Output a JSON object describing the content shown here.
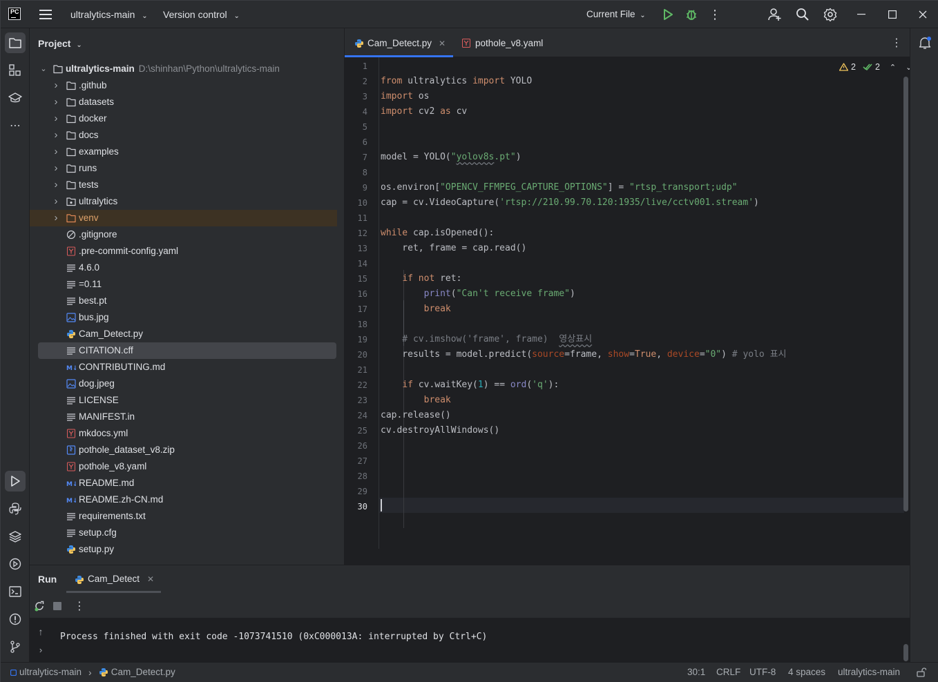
{
  "titlebar": {
    "logo_text": "PC",
    "project_name": "ultralytics-main",
    "vcs_label": "Version control",
    "run_config": "Current File"
  },
  "project_panel": {
    "title": "Project",
    "root": {
      "name": "ultralytics-main",
      "path": "D:\\shinhan\\Python\\ultralytics-main"
    },
    "items": [
      {
        "name": ".github",
        "kind": "folder"
      },
      {
        "name": "datasets",
        "kind": "folder"
      },
      {
        "name": "docker",
        "kind": "folder"
      },
      {
        "name": "docs",
        "kind": "folder"
      },
      {
        "name": "examples",
        "kind": "folder"
      },
      {
        "name": "runs",
        "kind": "folder"
      },
      {
        "name": "tests",
        "kind": "folder"
      },
      {
        "name": "ultralytics",
        "kind": "package"
      },
      {
        "name": "venv",
        "kind": "folder-excluded"
      },
      {
        "name": ".gitignore",
        "kind": "ignore"
      },
      {
        "name": ".pre-commit-config.yaml",
        "kind": "yaml"
      },
      {
        "name": "4.6.0",
        "kind": "text"
      },
      {
        "name": "=0.11",
        "kind": "text"
      },
      {
        "name": "best.pt",
        "kind": "text"
      },
      {
        "name": "bus.jpg",
        "kind": "image"
      },
      {
        "name": "Cam_Detect.py",
        "kind": "python"
      },
      {
        "name": "CITATION.cff",
        "kind": "text"
      },
      {
        "name": "CONTRIBUTING.md",
        "kind": "markdown"
      },
      {
        "name": "dog.jpeg",
        "kind": "image"
      },
      {
        "name": "LICENSE",
        "kind": "text"
      },
      {
        "name": "MANIFEST.in",
        "kind": "text"
      },
      {
        "name": "mkdocs.yml",
        "kind": "yaml"
      },
      {
        "name": "pothole_dataset_v8.zip",
        "kind": "archive"
      },
      {
        "name": "pothole_v8.yaml",
        "kind": "yaml"
      },
      {
        "name": "README.md",
        "kind": "markdown"
      },
      {
        "name": "README.zh-CN.md",
        "kind": "markdown"
      },
      {
        "name": "requirements.txt",
        "kind": "text"
      },
      {
        "name": "setup.cfg",
        "kind": "text"
      },
      {
        "name": "setup.py",
        "kind": "python"
      }
    ],
    "selected_item": "CITATION.cff",
    "highlighted_item": "venv"
  },
  "editor": {
    "tabs": [
      {
        "label": "Cam_Detect.py",
        "active": true
      },
      {
        "label": "pothole_v8.yaml",
        "active": false
      }
    ],
    "warnings_count": "2",
    "ok_count": "2",
    "current_line": "30"
  },
  "run_panel": {
    "title": "Run",
    "tab_label": "Cam_Detect",
    "console_output": "Process finished with exit code -1073741510 (0xC000013A: interrupted by Ctrl+C)"
  },
  "status_bar": {
    "breadcrumb_project": "ultralytics-main",
    "breadcrumb_file": "Cam_Detect.py",
    "position": "30:1",
    "line_ending": "CRLF",
    "encoding": "UTF-8",
    "indent": "4 spaces",
    "interpreter": "ultralytics-main"
  },
  "colors": {
    "accent": "#3574f0",
    "run_green": "#5fb865",
    "warning": "#f2c55c",
    "keyword": "#cf8e6d",
    "string": "#6aab73"
  }
}
